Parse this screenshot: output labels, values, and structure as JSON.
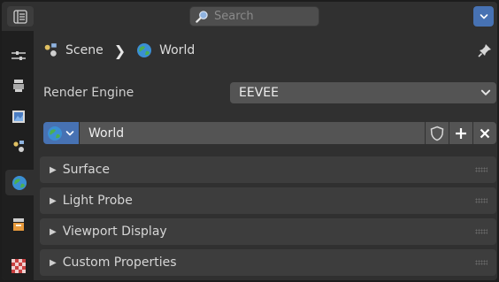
{
  "header": {
    "search_placeholder": "Search"
  },
  "tabs": [
    {
      "icon": "tool-icon"
    },
    {
      "icon": "render-icon"
    },
    {
      "icon": "output-icon"
    },
    {
      "icon": "view-layer-icon"
    },
    {
      "icon": "scene-icon"
    },
    {
      "icon": "world-icon",
      "active": true
    },
    {
      "icon": "collection-icon"
    },
    {
      "icon": "texture-icon"
    }
  ],
  "breadcrumb": {
    "scene_label": "Scene",
    "world_label": "World"
  },
  "render": {
    "engine_label": "Render Engine",
    "engine_value": "EEVEE"
  },
  "world": {
    "name": "World"
  },
  "panels": [
    {
      "label": "Surface"
    },
    {
      "label": "Light Probe"
    },
    {
      "label": "Viewport Display"
    },
    {
      "label": "Custom Properties"
    }
  ],
  "colors": {
    "accent": "#4772b3",
    "background": "#303030",
    "panel": "#3d3d3d",
    "field": "#545454"
  }
}
